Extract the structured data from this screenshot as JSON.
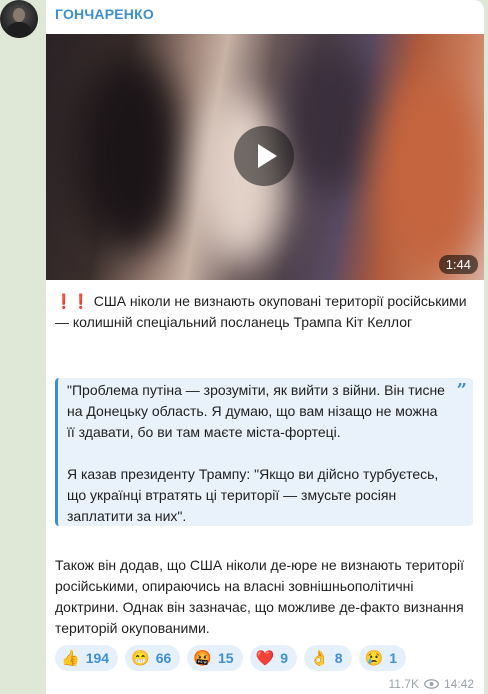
{
  "channel": {
    "name": "ГОНЧАРЕНКО"
  },
  "video": {
    "duration": "1:44"
  },
  "post": {
    "headline_marks": "❗❗",
    "headline": "США ніколи не визнають окуповані території російськими — колишній спеціальний посланець Трампа Кіт Келлог",
    "quote": {
      "paragraph1": "\"Проблема путіна — зрозуміти, як вийти з війни. Він тисне на Донецьку область. Я думаю, що вам нізащо не можна її здавати, бо ви там маєте міста-фортеці.",
      "paragraph2": "Я казав президенту Трампу: \"Якщо ви дійсно турбуєтесь, що українці втратять ці території — змусьте росіян заплатити за них\".",
      "mark": "”"
    },
    "body": "Також він додав, що США ніколи де-юре не визнають території російськими, опираючись на власні зовнішньополітичні доктрини. Однак він зазначає, що можливе де-факто визнання територій окупованими."
  },
  "reactions": [
    {
      "emoji": "👍",
      "icon": "thumbs-up",
      "count": "194"
    },
    {
      "emoji": "😁",
      "icon": "grin",
      "count": "66"
    },
    {
      "emoji": "🤬",
      "icon": "angry-face",
      "count": "15"
    },
    {
      "emoji": "❤️",
      "icon": "red-heart",
      "count": "9"
    },
    {
      "emoji": "👌",
      "icon": "ok-hand",
      "count": "8"
    },
    {
      "emoji": "😢",
      "icon": "crying-face",
      "count": "1"
    }
  ],
  "meta": {
    "views": "11.7K",
    "time": "14:42"
  },
  "colors": {
    "accent": "#3d8fd1",
    "background": "#dfe8d6",
    "quote_bg": "#e9f1fa",
    "alert": "#e53935"
  }
}
